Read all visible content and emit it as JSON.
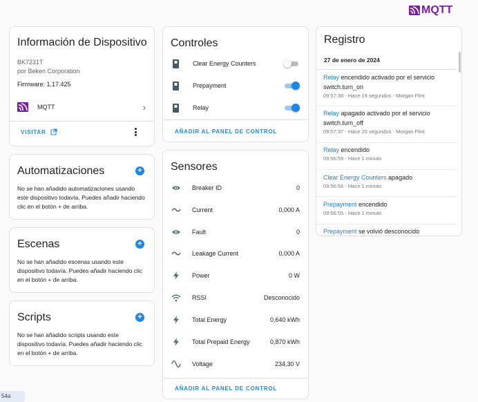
{
  "header": {
    "brand": "MQTT",
    "brand_color": "#7b1fa2"
  },
  "device": {
    "title": "Información de Dispositivo",
    "model": "BK7231T",
    "manufacturer": "por Beken Corporation",
    "firmware": "Firmware: 1.17.425",
    "integration": "MQTT",
    "visit_label": "VISITAR"
  },
  "automations": {
    "title": "Automatizaciones",
    "empty_text": "No se han añadido automatizaciones usando este dispositivo todavía. Puedes añadir haciendo clic en el botón + de arriba."
  },
  "scenes": {
    "title": "Escenas",
    "empty_text": "No se han añadido escenas usando este dispositivo todavía. Puedes añadir haciendo clic en el botón + de arriba."
  },
  "scripts": {
    "title": "Scripts",
    "empty_text": "No se han añadido scripts usando este dispositivo todavía. Puedes añadir haciendo clic en el botón + de arriba."
  },
  "controls": {
    "title": "Controles",
    "items": [
      {
        "label": "Clear Energy Counters",
        "state": "off"
      },
      {
        "label": "Prepayment",
        "state": "on"
      },
      {
        "label": "Relay",
        "state": "on"
      }
    ],
    "add_label": "AÑADIR AL PANEL DE CONTROL"
  },
  "sensors": {
    "title": "Sensores",
    "items": [
      {
        "label": "Breaker ID",
        "value": "0",
        "icon": "eye-icon"
      },
      {
        "label": "Current",
        "value": "0,000 A",
        "icon": "current-ac-icon"
      },
      {
        "label": "Fault",
        "value": "0",
        "icon": "eye-icon"
      },
      {
        "label": "Leakage Current",
        "value": "0,000 A",
        "icon": "current-ac-icon"
      },
      {
        "label": "Power",
        "value": "0 W",
        "icon": "flash-icon"
      },
      {
        "label": "RSSI",
        "value": "Desconocido",
        "icon": "wifi-icon"
      },
      {
        "label": "Total Energy",
        "value": "0,640 kWh",
        "icon": "flash-icon"
      },
      {
        "label": "Total Prepaid Energy",
        "value": "0,870 kWh",
        "icon": "flash-icon"
      },
      {
        "label": "Voltage",
        "value": "234,30 V",
        "icon": "sine-wave-icon"
      }
    ],
    "add_label": "AÑADIR AL PANEL DE CONTROL"
  },
  "log": {
    "title": "Registro",
    "date": "27 de enero de 2024",
    "entries": [
      {
        "entity": "Relay",
        "text": " encendido activado por el servicio switch.turn_on",
        "meta": "09:57:38 - Hace 19 segundos - Morgan Flint"
      },
      {
        "entity": "Relay",
        "text": " apagado activado por el servicio switch.turn_off",
        "meta": "09:57:37 - Hace 20 segundos - Morgan Flint"
      },
      {
        "entity": "Relay",
        "text": " encendido",
        "meta": "09:56:59 - Hace 1 minuto"
      },
      {
        "entity": "Clear Energy Counters",
        "text": " apagado",
        "meta": "09:56:56 - Hace 1 minuto"
      },
      {
        "entity": "Prepayment",
        "text": " encendido",
        "meta": "09:56:55 - Hace 1 minuto"
      },
      {
        "entity": "Prepayment",
        "text": " se volvió desconocido",
        "meta": ""
      }
    ]
  },
  "corner_tag": "54a",
  "colors": {
    "accent": "#1e88e5",
    "toggle_on": "#1e88e5",
    "toggle_off": "#bdbdbd"
  }
}
